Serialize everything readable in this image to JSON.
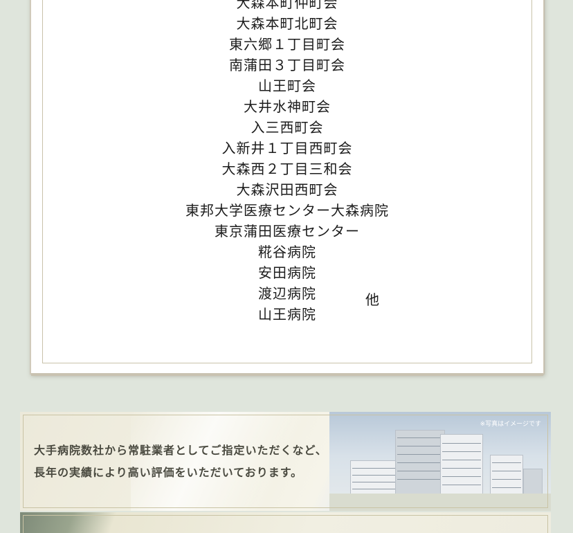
{
  "facilities": [
    "大森本町仲町会",
    "大森本町北町会",
    "東六郷１丁目町会",
    "南蒲田３丁目町会",
    "山王町会",
    "大井水神町会",
    "入三西町会",
    "入新井１丁目西町会",
    "大森西２丁目三和会",
    "大森沢田西町会",
    "東邦大学医療センター大森病院",
    "東京蒲田医療センター",
    "糀谷病院",
    "安田病院",
    "渡辺病院",
    "山王病院"
  ],
  "other_label": "他",
  "banner": {
    "line1": "大手病院数社から常駐業者としてご指定いただくなど、",
    "line2": "長年の実績により高い評価をいただいております。",
    "note": "※写真はイメージです"
  }
}
